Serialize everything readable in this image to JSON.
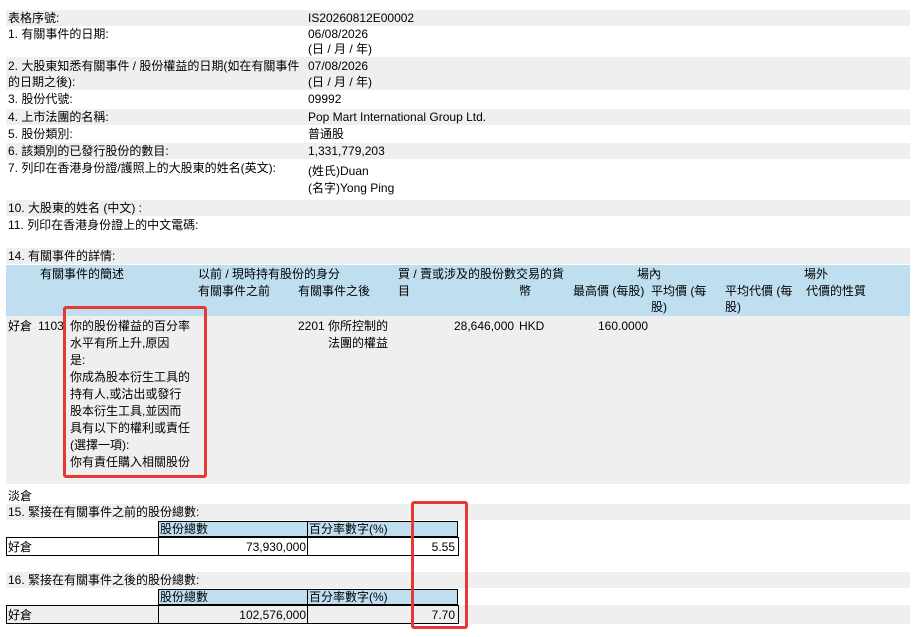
{
  "form": {
    "serial_label": "表格序號:",
    "serial_value": "IS20260812E00002",
    "q1_label": "1. 有關事件的日期:",
    "q1_value": "06/08/2026",
    "q1_fmt": "(日 / 月 / 年)",
    "q2_label_1": "2. 大股東知悉有關事件 / 股份權益的日期(如在有關事件",
    "q2_label_2": "的日期之後):",
    "q2_value": "07/08/2026",
    "q2_fmt": "(日 / 月 / 年)",
    "q3_label": "3. 股份代號:",
    "q3_value": "09992",
    "q4_label": "4. 上市法團的名稱:",
    "q4_value": "Pop Mart International Group Ltd.",
    "q5_label": "5. 股份類別:",
    "q5_value": "普通股",
    "q6_label": "6. 該類別的已發行股份的數目:",
    "q6_value": "1,331,779,203",
    "q7_label": "7. 列印在香港身份證/護照上的大股東的姓名(英文):",
    "q7_surname": "(姓氏)Duan",
    "q7_given": "(名字)Yong Ping",
    "q10_label": "10. 大股東的姓名 (中文) :",
    "q11_label": "11. 列印在香港身份證上的中文電碼:",
    "q14_label": "14. 有關事件的詳情:"
  },
  "event_table": {
    "h_desc": "有關事件的簡述",
    "h_capacity": "以前 / 現時持有股份的身分",
    "h_before": "有關事件之前",
    "h_after": "有關事件之後",
    "h_shares_1": "買 / 賣或涉及的股份數交易的貨",
    "h_shares_2": "目",
    "h_currency": "幣",
    "h_onex": "場內",
    "h_high": "最高價 (每股)",
    "h_avg_1": "平均價 (每",
    "h_avg_2": "股)",
    "h_offex": "場外",
    "h_offavg": "平均代價 (每",
    "h_offavg_2": "股)",
    "h_nature": "代價的性質",
    "row": {
      "position": "好倉",
      "code_before": "1103",
      "desc_1": "你的股份權益的百分率",
      "desc_2": "水平有所上升,原因",
      "desc_3": "是:",
      "desc_4": "你成為股本衍生工具的",
      "desc_5": "持有人,或沽出或發行",
      "desc_6": "股本衍生工具,並因而",
      "desc_7": "具有以下的權利或責任",
      "desc_8": "(選擇一項):",
      "desc_9": "你有責任購入相關股份",
      "code_after": "2201",
      "cap_1": "你所控制的",
      "cap_2": "法團的權益",
      "shares": "28,646,000",
      "currency": "HKD",
      "high": "160.0000"
    },
    "short_label": "淡倉"
  },
  "q15": {
    "label": "15. 緊接在有關事件之前的股份總數:",
    "h_total": "股份總數",
    "h_pct": "百分率數字(%)",
    "row_label": "好倉",
    "total": "73,930,000",
    "pct": "5.55"
  },
  "q16": {
    "label": "16. 緊接在有關事件之後的股份總數:",
    "h_total": "股份總數",
    "h_pct": "百分率數字(%)",
    "row_label": "好倉",
    "total": "102,576,000",
    "pct": "7.70"
  },
  "colors": {
    "header_blue": "#bfdff0",
    "row_gray": "#efefef",
    "highlight": "#e53935"
  }
}
